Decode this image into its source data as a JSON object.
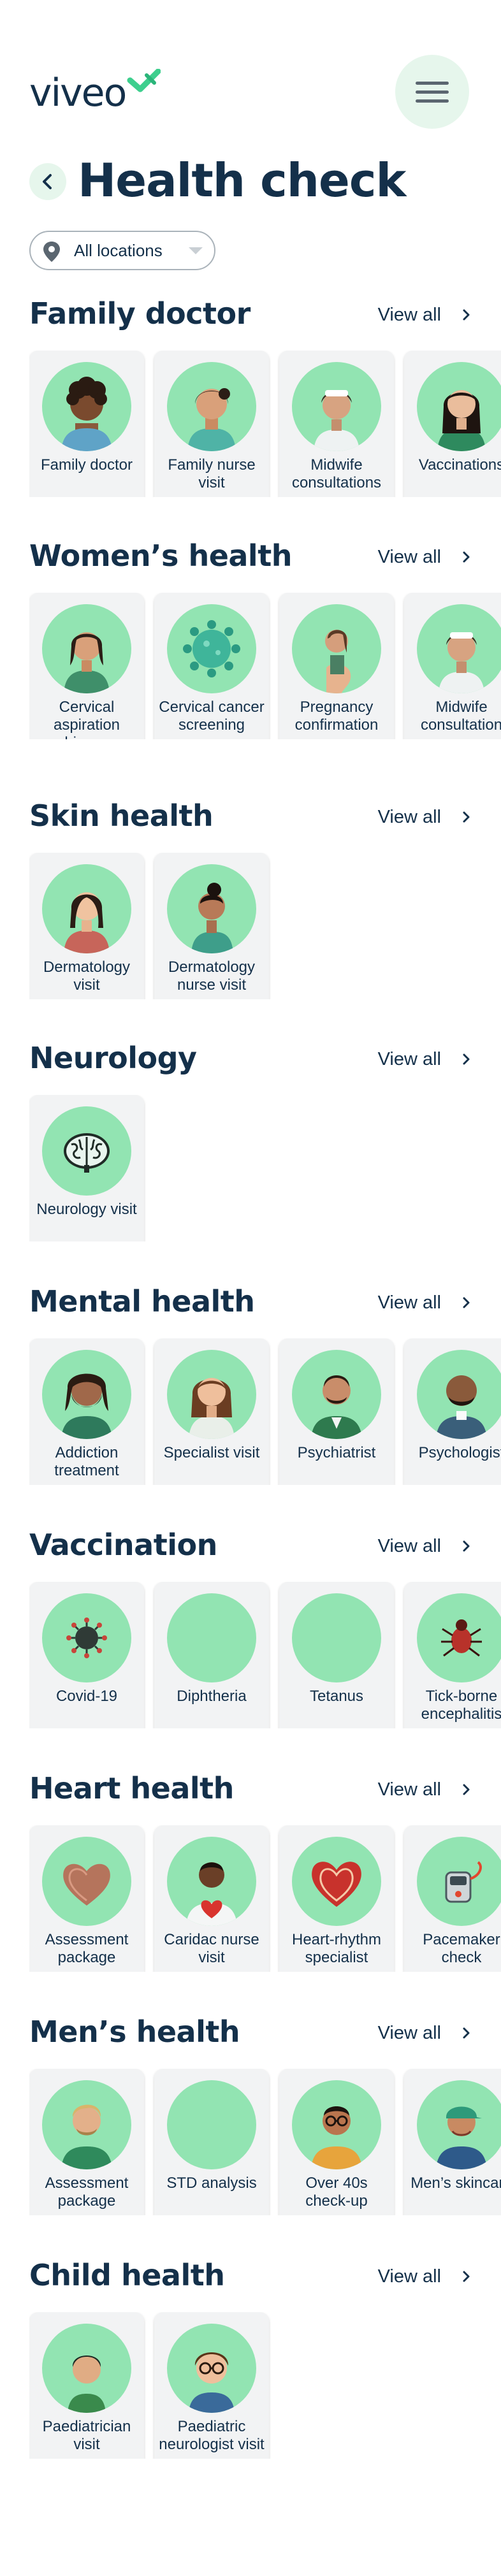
{
  "brand": {
    "name": "viveo",
    "accent": "#3ecf8e"
  },
  "header": {
    "menu_icon": "hamburger-icon"
  },
  "page": {
    "title": "Health check",
    "back_icon": "chevron-left-icon"
  },
  "location_filter": {
    "value": "All locations",
    "icon": "location-pin-icon"
  },
  "colors": {
    "text": "#14304a",
    "avatar_bg": "#92e4b2",
    "card_bg": "#f2f3f4",
    "pill_bg": "#e6f6ec"
  },
  "sections": [
    {
      "title": "Family doctor",
      "view_all": "View all",
      "cards": [
        {
          "label": "Family doctor",
          "art": "person-dark-curly"
        },
        {
          "label": "Family nurse visit",
          "art": "nurse-female"
        },
        {
          "label": "Midwife consultations",
          "art": "midwife"
        },
        {
          "label": "Vaccinations",
          "art": "nurse-long-hair"
        }
      ]
    },
    {
      "title": "Women’s health",
      "view_all": "View all",
      "cards": [
        {
          "label": "Cervical aspiration biopsy",
          "art": "woman-bun"
        },
        {
          "label": "Cervical cancer screening",
          "art": "virus-cell"
        },
        {
          "label": "Pregnancy confirmation",
          "art": "pregnant-woman"
        },
        {
          "label": "Midwife consultation",
          "art": "midwife"
        }
      ]
    },
    {
      "title": "Skin health",
      "view_all": "View all",
      "cards": [
        {
          "label": "Dermatology visit",
          "art": "woman-red-top"
        },
        {
          "label": "Dermatology nurse visit",
          "art": "nurse-profile"
        }
      ]
    },
    {
      "title": "Neurology",
      "view_all": "View all",
      "cards": [
        {
          "label": "Neurology visit",
          "art": "brain"
        }
      ]
    },
    {
      "title": "Mental health",
      "view_all": "View all",
      "cards": [
        {
          "label": "Addiction treatment",
          "art": "man-beard"
        },
        {
          "label": "Specialist visit",
          "art": "woman-brown-hair"
        },
        {
          "label": "Psychiatrist",
          "art": "man-green-jacket"
        },
        {
          "label": "Psychologist",
          "art": "man-bald"
        }
      ]
    },
    {
      "title": "Vaccination",
      "view_all": "View all",
      "cards": [
        {
          "label": "Covid-19",
          "art": "covid-virus"
        },
        {
          "label": "Diphtheria",
          "art": "empty"
        },
        {
          "label": "Tetanus",
          "art": "empty"
        },
        {
          "label": "Tick-borne encephalitis",
          "art": "tick"
        }
      ]
    },
    {
      "title": "Heart health",
      "view_all": "View all",
      "cards": [
        {
          "label": "Assessment package",
          "art": "heart-brown"
        },
        {
          "label": "Caridac nurse visit",
          "art": "man-holding-heart"
        },
        {
          "label": "Heart-rhythm specialist",
          "art": "heart-red"
        },
        {
          "label": "Pacemaker check",
          "art": "pacemaker"
        }
      ]
    },
    {
      "title": "Men’s health",
      "view_all": "View all",
      "cards": [
        {
          "label": "Assessment package",
          "art": "man-blond"
        },
        {
          "label": "STD analysis",
          "art": "empty"
        },
        {
          "label": "Over 40s check-up",
          "art": "man-glasses"
        },
        {
          "label": "Men’s skincare",
          "art": "man-cap"
        }
      ]
    },
    {
      "title": "Child health",
      "view_all": "View all",
      "cards": [
        {
          "label": "Paediatrician visit",
          "art": "child-green"
        },
        {
          "label": "Paediatric neurologist visit",
          "art": "child-glasses"
        }
      ]
    }
  ]
}
